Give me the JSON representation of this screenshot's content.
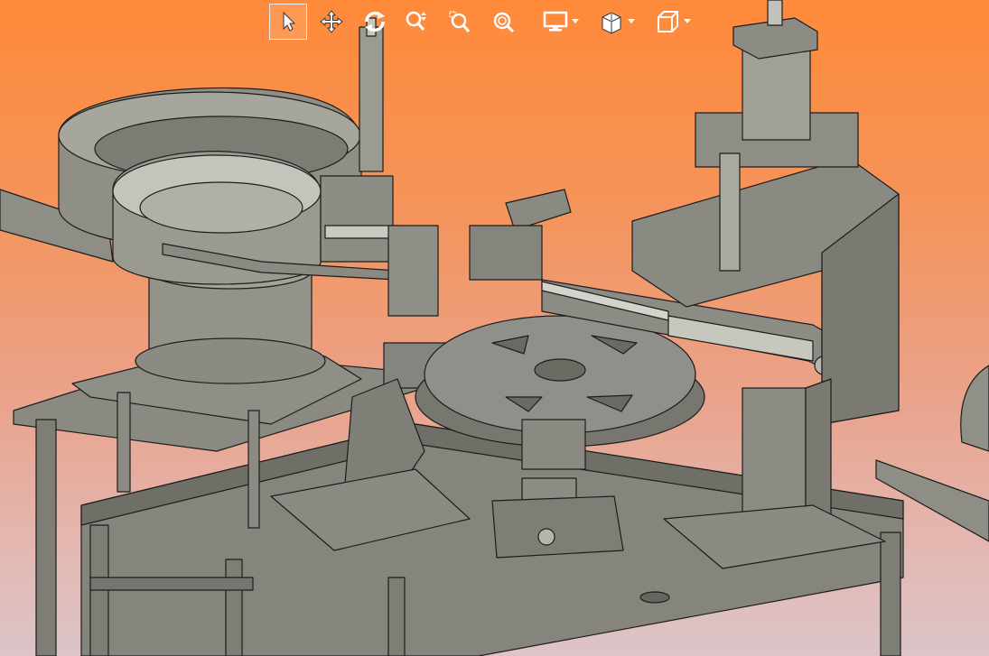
{
  "colors": {
    "background_top": "#ff8a3a",
    "background_bottom": "#dcc4c8",
    "model_body": "#8c8c84",
    "model_edge": "#1c1c1c",
    "toolbar_icon": "#ffffff",
    "toolbar_active_border": "#e8e8e8"
  },
  "toolbar": {
    "tools": [
      {
        "name": "select",
        "icon": "cursor-arrow-icon",
        "active": true
      },
      {
        "name": "pan",
        "icon": "move-arrows-icon",
        "active": false
      },
      {
        "name": "rotate",
        "icon": "rotate-icon",
        "active": false
      },
      {
        "name": "zoom",
        "icon": "zoom-updown-icon",
        "active": false
      },
      {
        "name": "zoom-window",
        "icon": "zoom-window-icon",
        "active": false
      },
      {
        "name": "zoom-fit",
        "icon": "zoom-fit-icon",
        "active": false
      },
      {
        "name": "display",
        "icon": "monitor-icon",
        "has_dropdown": true
      },
      {
        "name": "section",
        "icon": "section-cube-icon",
        "has_dropdown": true
      },
      {
        "name": "view",
        "icon": "view-cube-icon",
        "has_dropdown": true
      }
    ]
  },
  "scene": {
    "description_icon": "cad-3d-model",
    "model_name": ""
  }
}
